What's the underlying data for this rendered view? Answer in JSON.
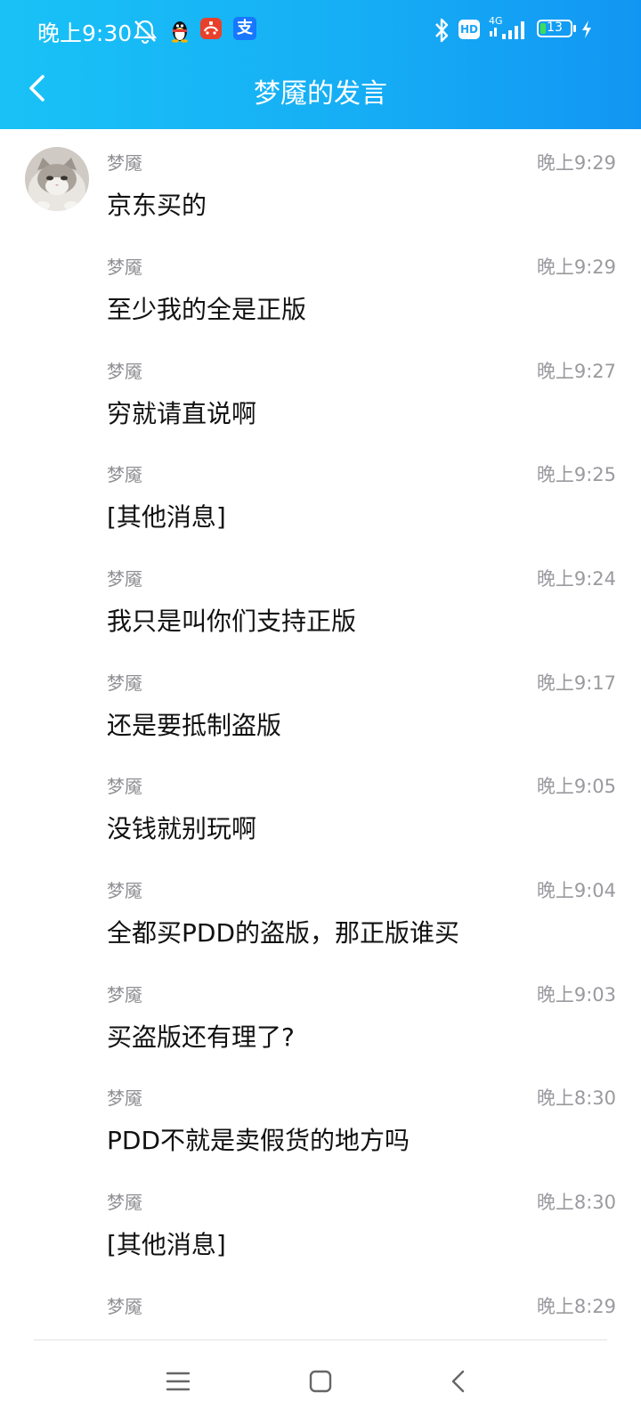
{
  "status_bar": {
    "time": "晚上9:30",
    "battery": "13",
    "network": "4G",
    "hd_label": "HD",
    "alipay_glyph": "支"
  },
  "header": {
    "title": "梦魇的发言"
  },
  "messages": [
    {
      "sender": "梦魇",
      "time": "晚上9:29",
      "text": "京东买的"
    },
    {
      "sender": "梦魇",
      "time": "晚上9:29",
      "text": "至少我的全是正版"
    },
    {
      "sender": "梦魇",
      "time": "晚上9:27",
      "text": "穷就请直说啊"
    },
    {
      "sender": "梦魇",
      "time": "晚上9:25",
      "text": "[其他消息]"
    },
    {
      "sender": "梦魇",
      "time": "晚上9:24",
      "text": "我只是叫你们支持正版"
    },
    {
      "sender": "梦魇",
      "time": "晚上9:17",
      "text": "还是要抵制盗版"
    },
    {
      "sender": "梦魇",
      "time": "晚上9:05",
      "text": "没钱就别玩啊"
    },
    {
      "sender": "梦魇",
      "time": "晚上9:04",
      "text": "全都买PDD的盗版，那正版谁买"
    },
    {
      "sender": "梦魇",
      "time": "晚上9:03",
      "text": "买盗版还有理了?"
    },
    {
      "sender": "梦魇",
      "time": "晚上8:30",
      "text": "PDD不就是卖假货的地方吗"
    },
    {
      "sender": "梦魇",
      "time": "晚上8:30",
      "text": "[其他消息]"
    },
    {
      "sender": "梦魇",
      "time": "晚上8:29",
      "text": ""
    }
  ],
  "icons": {
    "back": "chevron-left-icon",
    "menu": "menu-icon",
    "home": "home-square-icon",
    "nav_back": "nav-back-icon"
  },
  "colors": {
    "header_start": "#19c2f6",
    "header_end": "#1296f3",
    "battery_fill": "#3ddc5a"
  }
}
